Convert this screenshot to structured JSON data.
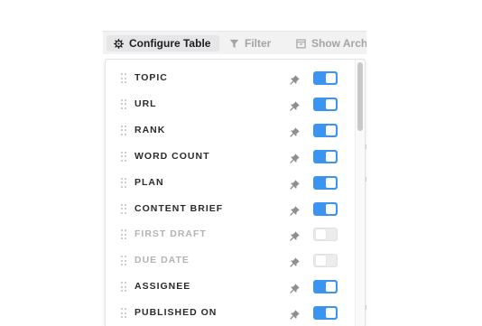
{
  "toolbar": {
    "configure_label": "Configure Table",
    "filter_label": "Filter",
    "archive_label": "Show Archi",
    "configure_icon": "gear-icon",
    "filter_icon": "funnel-icon",
    "archive_icon": "archive-box-icon"
  },
  "columns": [
    {
      "label": "TOPIC",
      "enabled": true
    },
    {
      "label": "URL",
      "enabled": true
    },
    {
      "label": "RANK",
      "enabled": true
    },
    {
      "label": "WORD COUNT",
      "enabled": true
    },
    {
      "label": "PLAN",
      "enabled": true
    },
    {
      "label": "CONTENT BRIEF",
      "enabled": true
    },
    {
      "label": "FIRST DRAFT",
      "enabled": false
    },
    {
      "label": "DUE DATE",
      "enabled": false
    },
    {
      "label": "ASSIGNEE",
      "enabled": true
    },
    {
      "label": "PUBLISHED ON",
      "enabled": true
    }
  ],
  "colors": {
    "toggle_on": "#3b93f2",
    "toggle_off": "#ececee",
    "label_enabled": "#2a2a2d",
    "label_disabled": "#b3b3b8"
  }
}
